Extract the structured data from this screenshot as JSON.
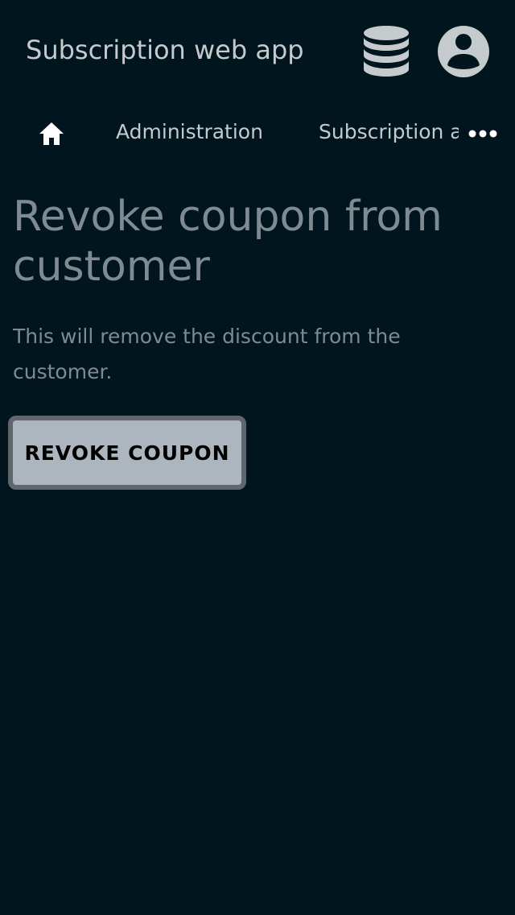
{
  "header": {
    "app_title": "Subscription web app",
    "database_icon": "database-icon",
    "account_icon": "account-circle-icon"
  },
  "nav": {
    "home_icon": "home-icon",
    "items": [
      {
        "label": "Administration"
      },
      {
        "label": "Subscription a"
      }
    ],
    "more_icon": "more-horizontal-icon"
  },
  "main": {
    "title": "Revoke coupon from customer",
    "description": "This will remove the discount from the customer.",
    "revoke_button_label": "REVOKE COUPON"
  },
  "colors": {
    "background": "#00151d",
    "header_text": "#c5cacd",
    "muted_text": "#7f8b91",
    "button_bg": "#adb6bf",
    "button_border": "#5f676d"
  }
}
